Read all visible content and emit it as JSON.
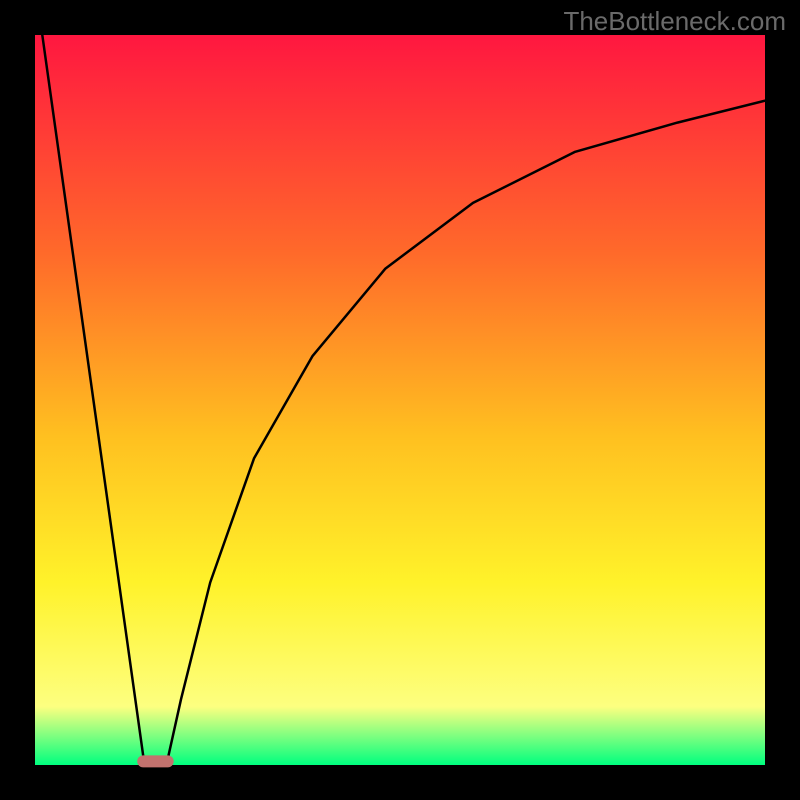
{
  "attribution": "TheBottleneck.com",
  "colors": {
    "frame": "#000000",
    "gradient_top": "#ff1740",
    "gradient_mid1": "#ff6a2a",
    "gradient_mid2": "#ffc020",
    "gradient_mid3": "#fff22a",
    "gradient_mid4": "#fdff80",
    "gradient_bottom": "#00ff7f",
    "curve": "#000000",
    "optimal_bar": "#c2726e"
  },
  "chart_data": {
    "type": "line",
    "title": "",
    "xlabel": "",
    "ylabel": "",
    "x_range": [
      0,
      100
    ],
    "y_range": [
      0,
      100
    ],
    "series": [
      {
        "name": "left-branch",
        "x": [
          1,
          15
        ],
        "y": [
          100,
          0
        ]
      },
      {
        "name": "right-branch",
        "x": [
          18,
          20,
          24,
          30,
          38,
          48,
          60,
          74,
          88,
          100
        ],
        "y": [
          0,
          9,
          25,
          42,
          56,
          68,
          77,
          84,
          88,
          91
        ]
      }
    ],
    "optimal_zone": {
      "x_start": 14,
      "x_end": 19,
      "y": 0.5
    },
    "frame_thickness_px": 35
  }
}
